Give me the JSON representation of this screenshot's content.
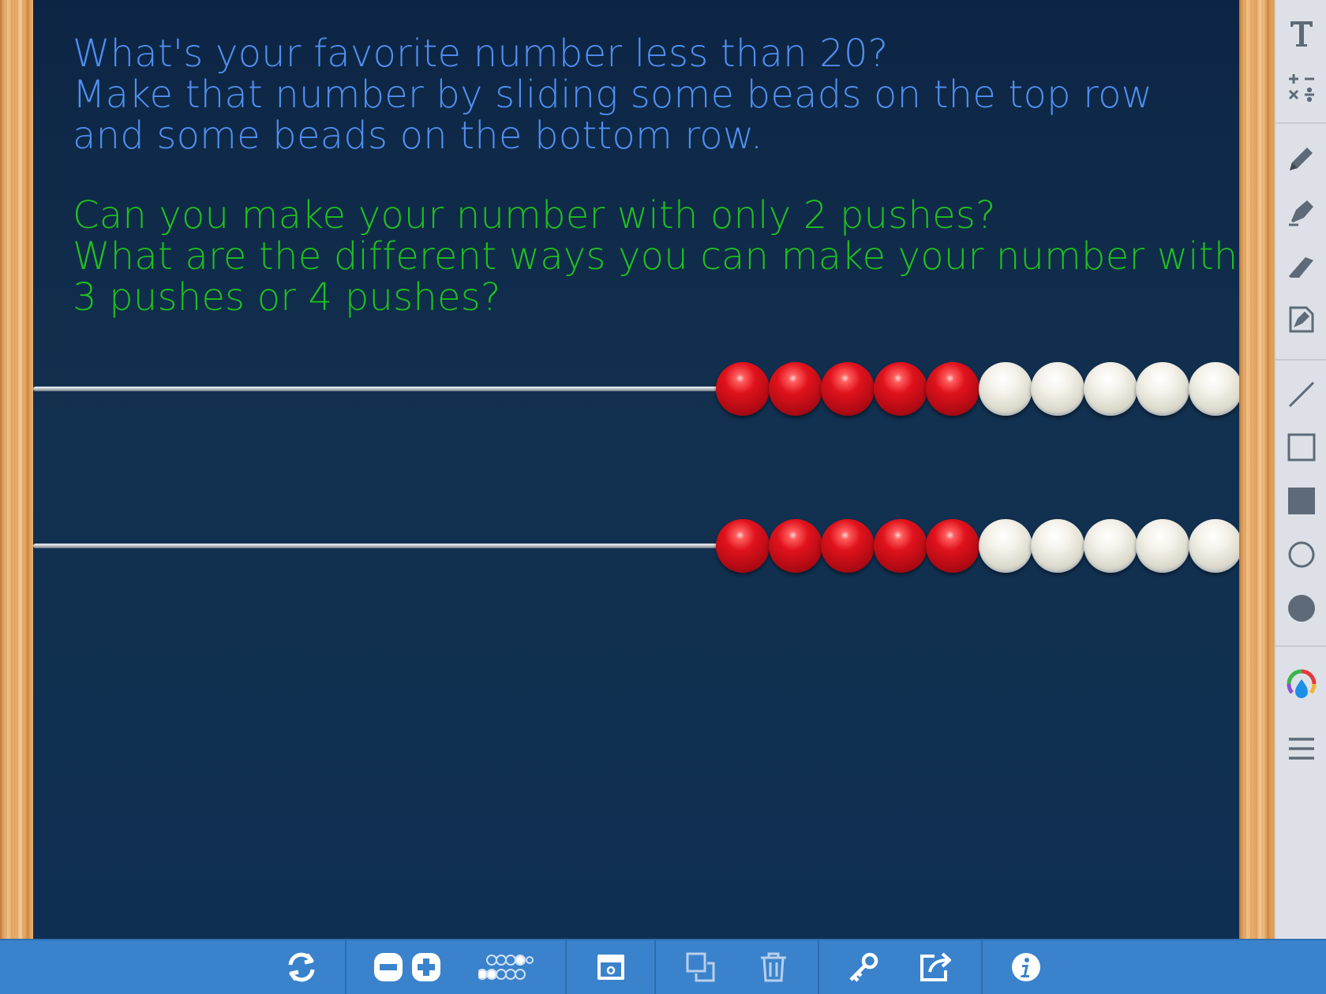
{
  "prompt": {
    "blue_lines": [
      "What's your favorite number less than 20?",
      "Make that number by sliding some beads on the top row",
      "and some beads on the bottom row."
    ],
    "green_lines": [
      "Can you make your number with only 2 pushes?",
      "What are the different ways you can make your number with",
      "3 pushes or 4 pushes?"
    ]
  },
  "colors": {
    "blue_text": "#4f8ff0",
    "green_text": "#1fbf1f",
    "bead_red": "#e0121c",
    "bead_white": "#f0eee4",
    "toolbar_blue": "#3a83cc"
  },
  "rekenrek": {
    "rows": [
      {
        "name": "top",
        "red": 5,
        "white": 5
      },
      {
        "name": "bottom",
        "red": 5,
        "white": 5
      }
    ]
  },
  "sidebar_tools": [
    "text-icon",
    "math-symbols-icon",
    "pencil-icon",
    "highlighter-icon",
    "eraser-icon",
    "note-icon",
    "line-icon",
    "rectangle-outline-icon",
    "rectangle-filled-icon",
    "circle-outline-icon",
    "circle-filled-icon",
    "color-picker-icon",
    "menu-icon"
  ],
  "bottom_tools": [
    "reset-icon",
    "minus-icon",
    "plus-icon",
    "bead-layout-icon",
    "cover-icon",
    "duplicate-icon",
    "trash-icon",
    "key-icon",
    "share-icon",
    "info-icon"
  ]
}
